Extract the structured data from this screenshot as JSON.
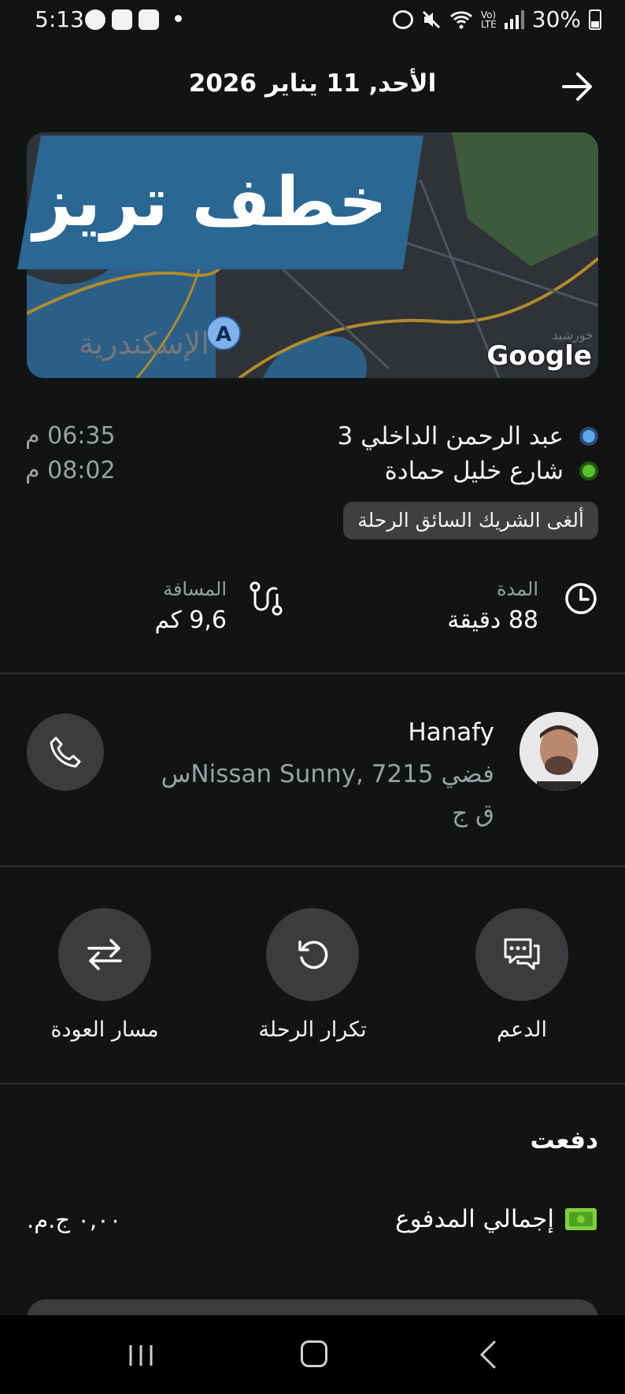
{
  "status_bar": {
    "time": "5:13",
    "battery": "30%",
    "left_icons": [
      "facebook-icon",
      "gallery-icon",
      "indrive-icon"
    ],
    "right_icons": [
      "alarm-icon",
      "mute-icon",
      "wifi-icon",
      "volte-icon",
      "signal-icon",
      "battery-icon"
    ]
  },
  "header": {
    "title": "الأحد, 11 يناير 2026"
  },
  "map": {
    "overlay_text": "خطف تريز",
    "attribution": "Google",
    "city_label": "الإسكندرية",
    "city_label_2": "خورشيد",
    "marker_label": "A"
  },
  "route": {
    "pickup": "عبد الرحمن الداخلي 3",
    "dropoff": "شارع خليل حمادة",
    "pickup_time": "06:35 م",
    "dropoff_time": "08:02 م",
    "cancel_status": "ألغى الشريك السائق الرحلة"
  },
  "stats": {
    "duration_label": "المدة",
    "duration_value": "88 دقيقة",
    "distance_label": "المسافة",
    "distance_value": "9,6 كم"
  },
  "driver": {
    "name": "Hanafy",
    "car_line": "فضي Nissan Sunny, 7215س",
    "plate_line": "ق ج"
  },
  "actions": {
    "support": "الدعم",
    "repeat": "تكرار الرحلة",
    "return": "مسار العودة"
  },
  "payment": {
    "title": "دفعت",
    "total_label": "إجمالي المدفوع",
    "total_value": "٠,٠٠ ج.م."
  },
  "colors": {
    "background": "#111413",
    "button_bg": "#3a3c3d",
    "banner_blue": "#2a6793",
    "pickup_dot": "#5ea8ec",
    "dropoff_dot": "#58c22b",
    "money_icon": "#7fd13b"
  }
}
